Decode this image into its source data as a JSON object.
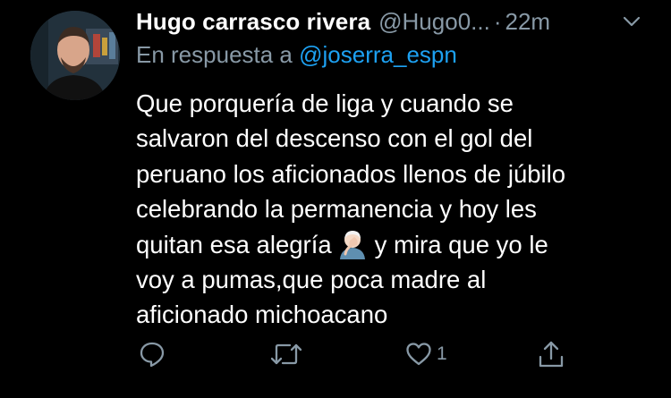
{
  "tweet": {
    "author": {
      "display_name": "Hugo carrasco rivera",
      "handle": "@Hugo0...",
      "separator": "·",
      "time": "22m"
    },
    "reply": {
      "prefix": "En respuesta a",
      "mention": "@joserra_espn"
    },
    "body": {
      "line1": "Que porquería de liga y cuando se",
      "line2": "salvaron del descenso con el gol del",
      "line3": "peruano los aficionados llenos de júbilo",
      "line4": "celebrando la permanencia y hoy les",
      "line5a": "quitan esa alegría",
      "line5b": "y mira que yo le",
      "line6": "voy a pumas,que poca madre al",
      "line7": "aficionado michoacano"
    },
    "emoji": "person-facepalming-emoji",
    "actions": {
      "reply_icon": "reply-icon",
      "retweet_icon": "retweet-icon",
      "like_icon": "like-icon",
      "like_count": "1",
      "share_icon": "share-icon"
    }
  },
  "colors": {
    "background": "#000000",
    "text": "#ffffff",
    "muted": "#8899a6",
    "link": "#1da1f2"
  }
}
